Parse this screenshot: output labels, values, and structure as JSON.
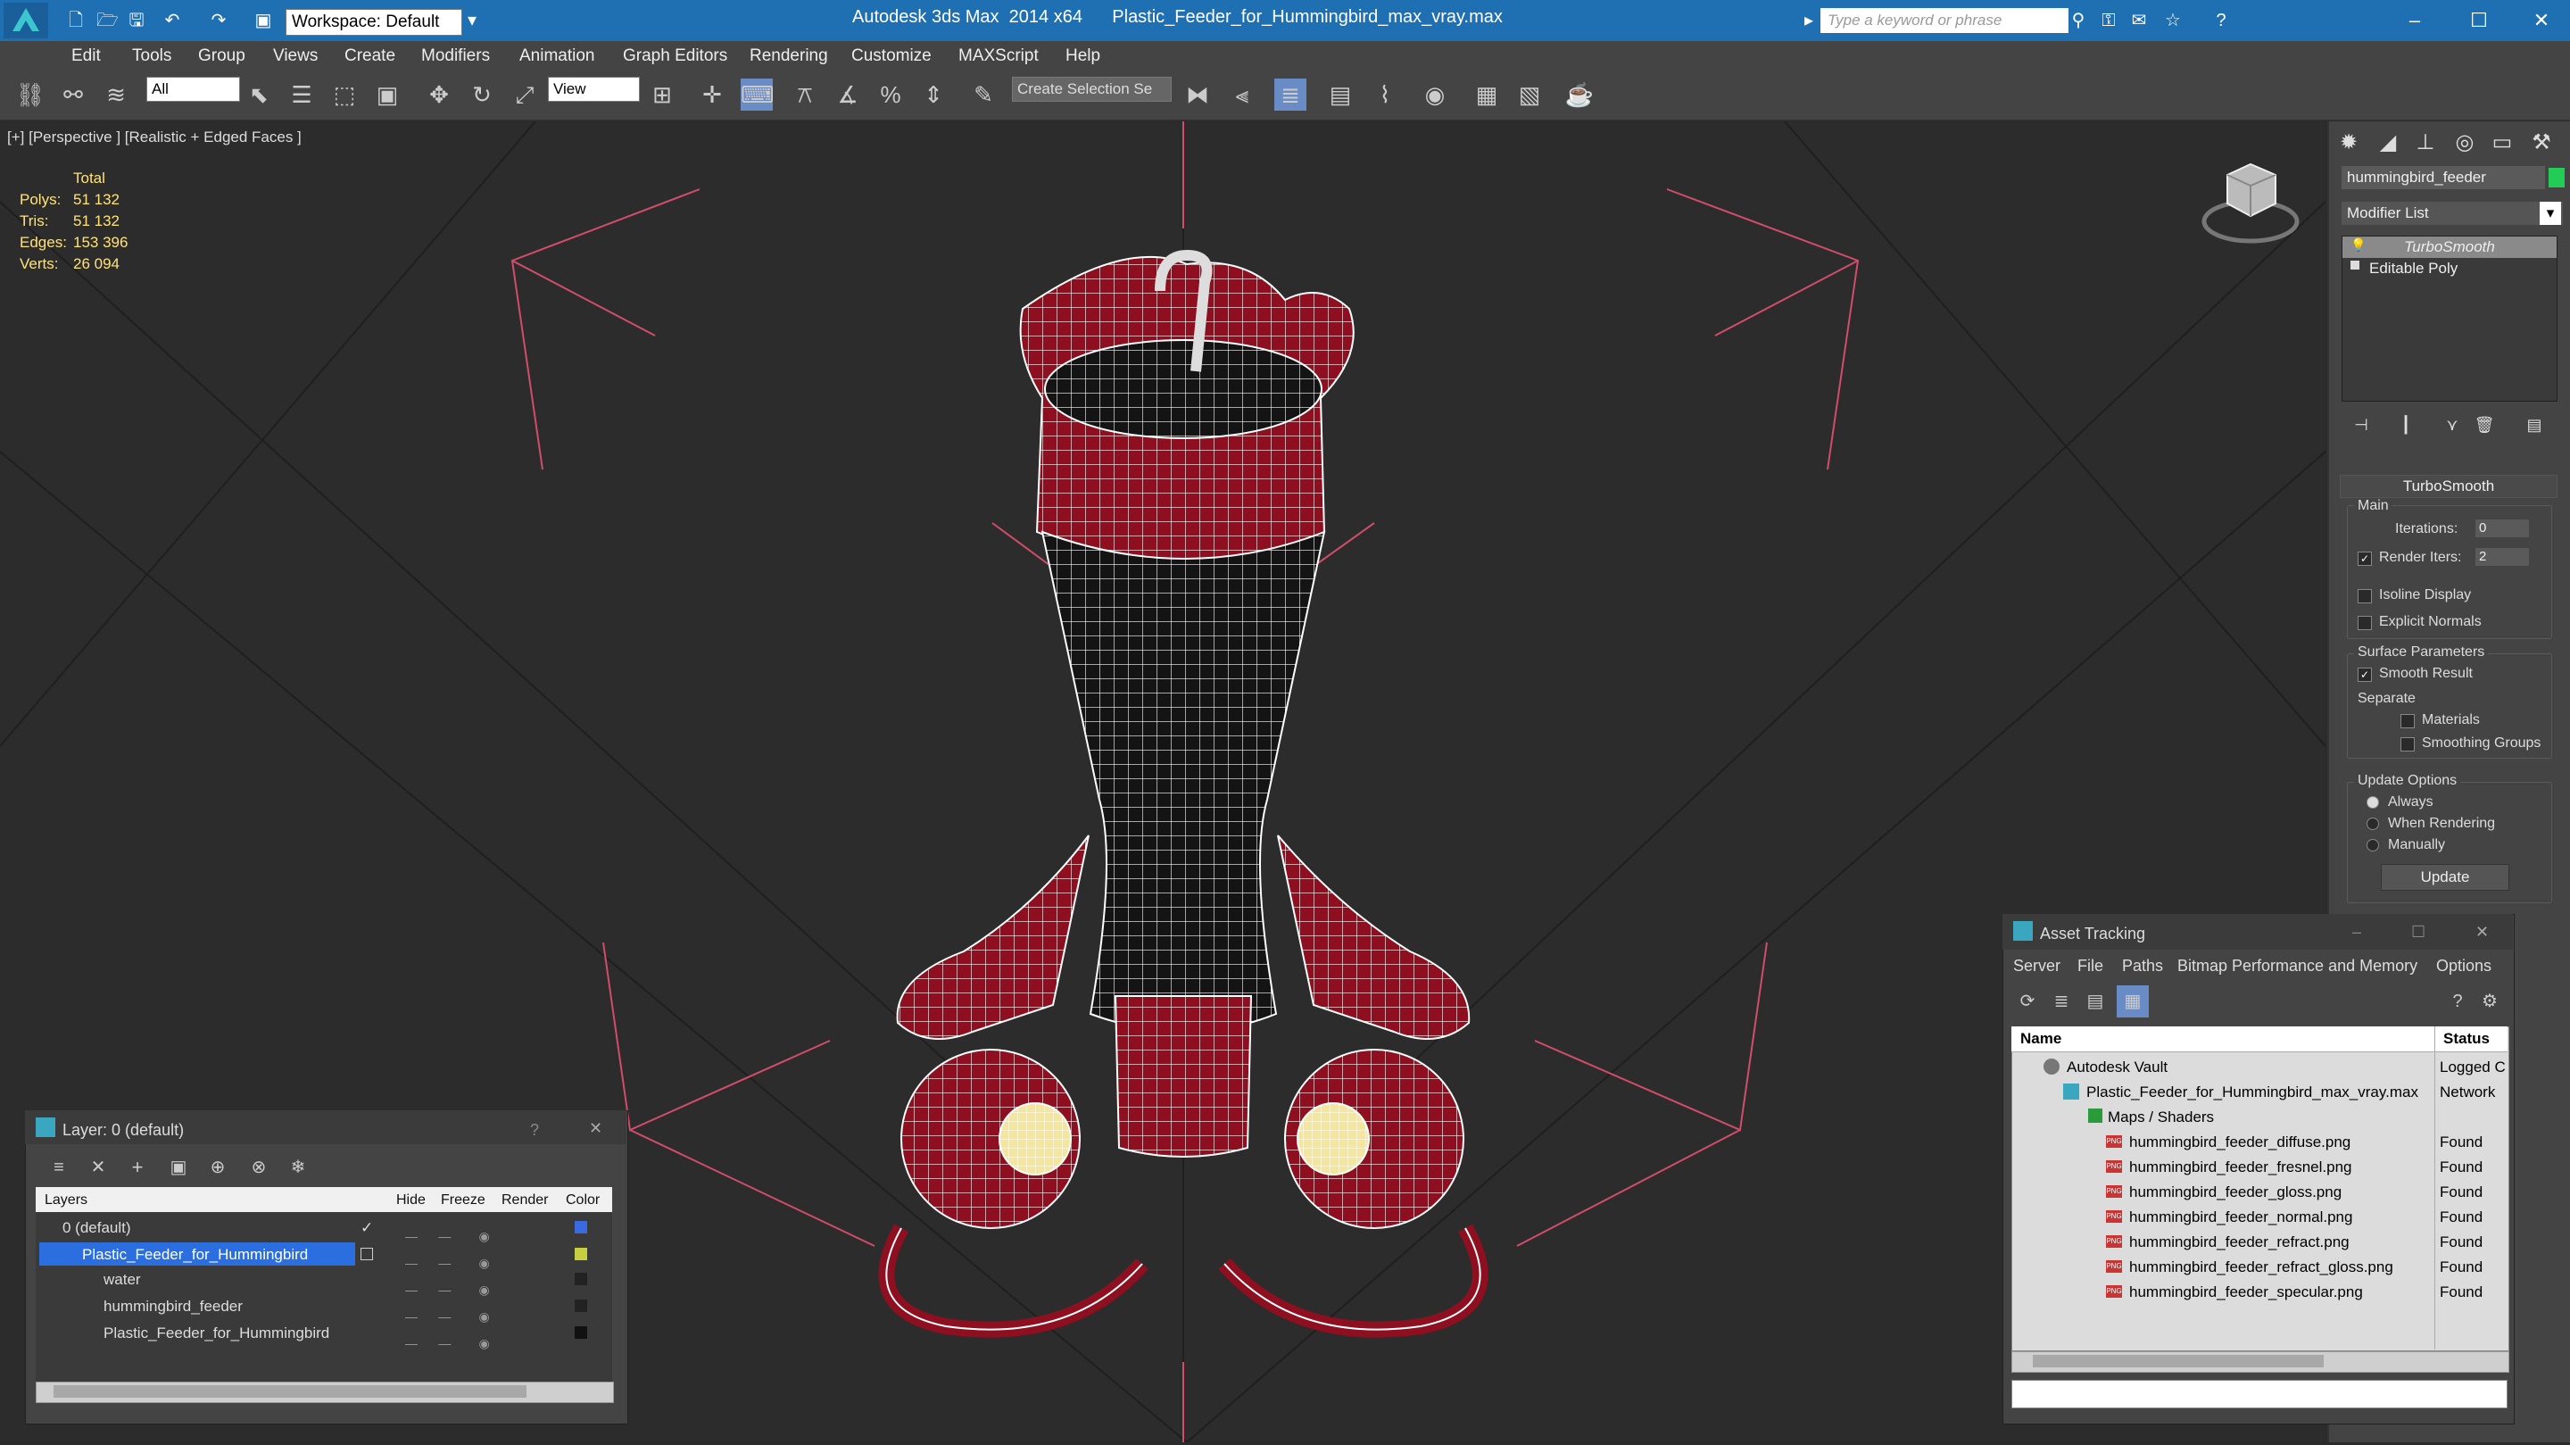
{
  "titlebar": {
    "workspace": "Workspace: Default",
    "title": "Autodesk 3ds Max  2014 x64      Plastic_Feeder_for_Hummingbird_max_vray.max",
    "search_placeholder": "Type a keyword or phrase"
  },
  "menu": [
    "Edit",
    "Tools",
    "Group",
    "Views",
    "Create",
    "Modifiers",
    "Animation",
    "Graph Editors",
    "Rendering",
    "Customize",
    "MAXScript",
    "Help"
  ],
  "toolbar": {
    "filter": "All",
    "ref_coord": "View",
    "selection_set": "Create Selection Se"
  },
  "viewport": {
    "label": "[+] [Perspective ] [Realistic + Edged Faces ]",
    "stats": {
      "header": "Total",
      "rows": [
        {
          "label": "Polys:",
          "value": "51 132"
        },
        {
          "label": "Tris:",
          "value": "51 132"
        },
        {
          "label": "Edges:",
          "value": "153 396"
        },
        {
          "label": "Verts:",
          "value": "26 094"
        }
      ]
    },
    "wire_color": "#ffffff",
    "mesh_color": "#8e1020"
  },
  "command_panel": {
    "object_name": "hummingbird_feeder",
    "modifier_list": "Modifier List",
    "stack": [
      "TurboSmooth",
      "Editable Poly"
    ],
    "rollout_title": "TurboSmooth",
    "main_label": "Main",
    "iterations_label": "Iterations:",
    "iterations_value": "0",
    "render_iters_label": "Render Iters:",
    "render_iters_value": "2",
    "isoline_label": "Isoline Display",
    "explicit_normals_label": "Explicit Normals",
    "surface_params_label": "Surface Parameters",
    "smooth_result_label": "Smooth Result",
    "separate_label": "Separate",
    "materials_label": "Materials",
    "smoothing_groups_label": "Smoothing Groups",
    "update_options_label": "Update Options",
    "always_label": "Always",
    "when_rendering_label": "When Rendering",
    "manually_label": "Manually",
    "update_button": "Update"
  },
  "layer_dialog": {
    "title": "Layer: 0 (default)",
    "help": "?",
    "columns": [
      "Layers",
      "Hide",
      "Freeze",
      "Render",
      "Color"
    ],
    "rows": [
      {
        "name": "0 (default)",
        "color": "#3a6adf"
      },
      {
        "name": "Plastic_Feeder_for_Hummingbird",
        "color": "#c8d040"
      },
      {
        "name": "water",
        "color": "#222222"
      },
      {
        "name": "hummingbird_feeder",
        "color": "#222222"
      },
      {
        "name": "Plastic_Feeder_for_Hummingbird",
        "color": "#111111"
      }
    ]
  },
  "asset_tracking": {
    "title": "Asset Tracking",
    "menu": [
      "Server",
      "File",
      "Paths",
      "Bitmap Performance and Memory",
      "Options"
    ],
    "columns": [
      "Name",
      "Status"
    ],
    "rows": [
      {
        "name": "Autodesk Vault",
        "status": "Logged C"
      },
      {
        "name": "Plastic_Feeder_for_Hummingbird_max_vray.max",
        "status": "Network"
      },
      {
        "name": "Maps / Shaders",
        "status": ""
      },
      {
        "name": "hummingbird_feeder_diffuse.png",
        "status": "Found"
      },
      {
        "name": "hummingbird_feeder_fresnel.png",
        "status": "Found"
      },
      {
        "name": "hummingbird_feeder_gloss.png",
        "status": "Found"
      },
      {
        "name": "hummingbird_feeder_normal.png",
        "status": "Found"
      },
      {
        "name": "hummingbird_feeder_refract.png",
        "status": "Found"
      },
      {
        "name": "hummingbird_feeder_refract_gloss.png",
        "status": "Found"
      },
      {
        "name": "hummingbird_feeder_specular.png",
        "status": "Found"
      }
    ]
  }
}
